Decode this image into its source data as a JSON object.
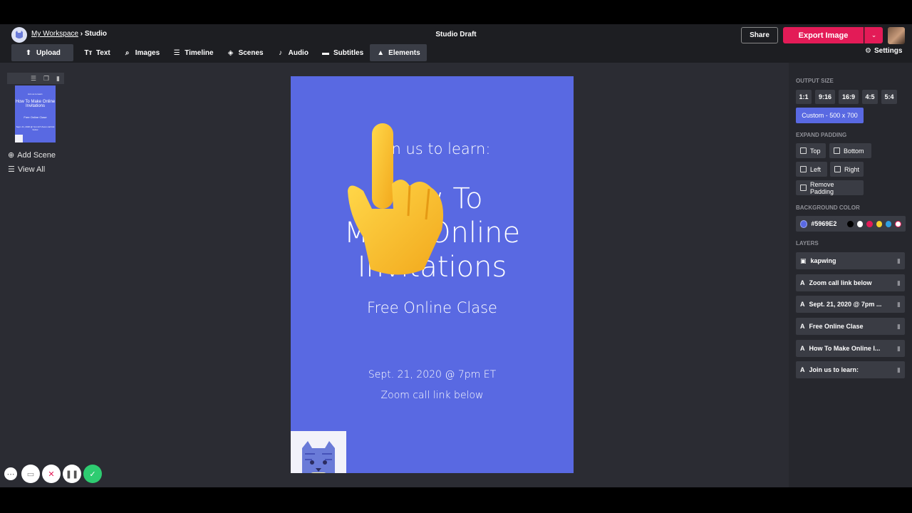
{
  "header": {
    "workspace": "My Workspace",
    "separator": "›",
    "section": "Studio",
    "title": "Studio Draft",
    "share_label": "Share",
    "export_label": "Export Image",
    "export_caret": "⌄",
    "settings_label": "Settings"
  },
  "toolbar": [
    {
      "label": "Upload",
      "icon": "upload-icon",
      "glyph": "⬆"
    },
    {
      "label": "Text",
      "icon": "text-icon",
      "glyph": "Tт"
    },
    {
      "label": "Images",
      "icon": "search-icon",
      "glyph": "⌕"
    },
    {
      "label": "Timeline",
      "icon": "timeline-icon",
      "glyph": "☰"
    },
    {
      "label": "Scenes",
      "icon": "layers-icon",
      "glyph": "◈"
    },
    {
      "label": "Audio",
      "icon": "music-note-icon",
      "glyph": "♪"
    },
    {
      "label": "Subtitles",
      "icon": "subtitles-icon",
      "glyph": "▬"
    },
    {
      "label": "Elements",
      "icon": "shapes-icon",
      "glyph": "▲"
    }
  ],
  "scenes": {
    "add_label": "Add Scene",
    "view_all_label": "View All",
    "thumb": {
      "join": "Join us to learn:",
      "how": "How To Make Online Invitations",
      "free": "Free Online Clase",
      "date": "Sept. 21, 2020 @ 7pm ET Zoom call link below"
    }
  },
  "canvas": {
    "join": "Join us to learn:",
    "how_line1": "How To",
    "how_line2": "Make Online",
    "how_line3": "Invitations",
    "free": "Free Online Clase",
    "date": "Sept. 21, 2020 @ 7pm ET",
    "zoom": "Zoom call link below",
    "background": "#5969E2"
  },
  "sidebar": {
    "output_size_heading": "OUTPUT SIZE",
    "ratios": [
      "1:1",
      "9:16",
      "16:9",
      "4:5",
      "5:4"
    ],
    "custom_label": "Custom - 500 x 700",
    "expand_padding_heading": "EXPAND PADDING",
    "padding": {
      "top": "Top",
      "bottom": "Bottom",
      "left": "Left",
      "right": "Right",
      "remove": "Remove Padding"
    },
    "background_heading": "BACKGROUND COLOR",
    "background_value": "#5969E2",
    "swatches": [
      "#000000",
      "#ffffff",
      "#e31b57",
      "#f5d02c",
      "#2fa0e0"
    ],
    "layers_heading": "LAYERS",
    "layers": [
      {
        "name": "kapwing",
        "icon": "image-icon"
      },
      {
        "name": "Zoom call link below",
        "icon": "text-layer-icon"
      },
      {
        "name": "Sept. 21, 2020 @ 7pm ...",
        "icon": "text-layer-icon"
      },
      {
        "name": "Free Online Clase",
        "icon": "text-layer-icon"
      },
      {
        "name": "How To Make Online I...",
        "icon": "text-layer-icon"
      },
      {
        "name": "Join us to learn:",
        "icon": "text-layer-icon"
      }
    ]
  },
  "recorder": {
    "colors": {
      "accent": "#2ecc71",
      "cancel": "#e31b57"
    }
  }
}
